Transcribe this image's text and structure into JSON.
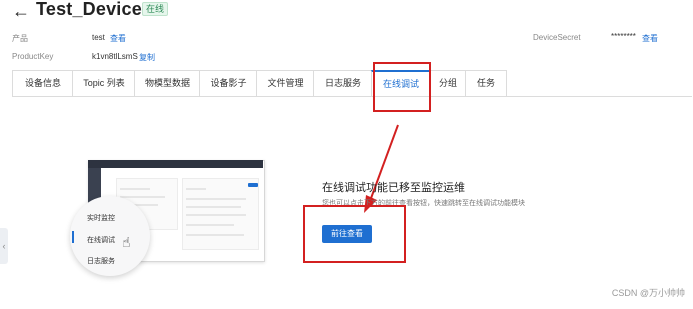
{
  "header": {
    "back_icon": "arrow-left-icon",
    "title": "Test_Device",
    "status": "在线"
  },
  "meta": {
    "product_label": "产品",
    "product_value": "test",
    "product_link": "查看",
    "productkey_label": "ProductKey",
    "productkey_value": "k1vn8tlLsmS",
    "productkey_link": "复制",
    "secret_label": "DeviceSecret",
    "secret_value": "********",
    "secret_link": "查看"
  },
  "tabs": [
    {
      "label": "设备信息"
    },
    {
      "label": "Topic 列表"
    },
    {
      "label": "物模型数据"
    },
    {
      "label": "设备影子"
    },
    {
      "label": "文件管理"
    },
    {
      "label": "日志服务"
    },
    {
      "label": "在线调试",
      "active": true
    },
    {
      "label": "分组"
    },
    {
      "label": "任务"
    }
  ],
  "illustration": {
    "menu": [
      "实时监控",
      "在线调试",
      "日志服务"
    ]
  },
  "notice": {
    "headline": "在线调试功能已移至监控运维",
    "subtext": "您也可以点击下方的前往查看按钮，快速跳转至在线调试功能模块",
    "button": "前往查看"
  },
  "watermark": "CSDN @万小帅帅",
  "colors": {
    "accent": "#1f6fd1",
    "highlight": "#d32020",
    "online": "#2e8b57"
  }
}
